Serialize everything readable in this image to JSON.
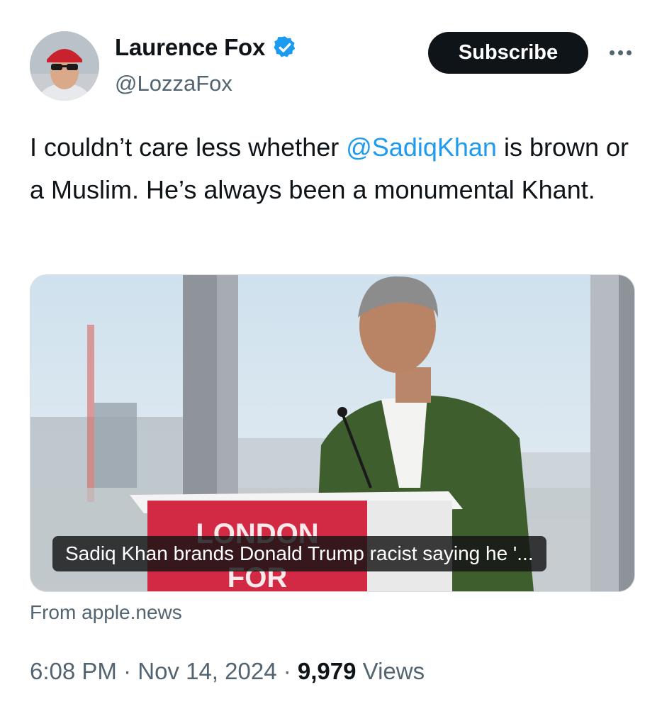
{
  "author": {
    "display_name": "Laurence Fox",
    "handle": "@LozzaFox",
    "verified": true
  },
  "header": {
    "subscribe_label": "Subscribe",
    "more_icon": "more-horizontal-icon"
  },
  "tweet": {
    "text_before": "I couldn’t care less whether ",
    "mention": "@SadiqKhan",
    "text_after": " is brown or a Muslim. He’s always been a monumental Khant."
  },
  "link_card": {
    "headline": "Sadiq Khan brands Donald Trump racist saying he '...",
    "podium_line1": "LONDON",
    "podium_line2": "FOR",
    "source": "From apple.news"
  },
  "meta": {
    "time": "6:08 PM",
    "separator": "·",
    "date": "Nov 14, 2024",
    "views_count": "9,979",
    "views_label": "Views"
  },
  "colors": {
    "accent": "#1d9bf0",
    "text": "#0f1419",
    "muted": "#536471",
    "podium": "#d22a45"
  }
}
